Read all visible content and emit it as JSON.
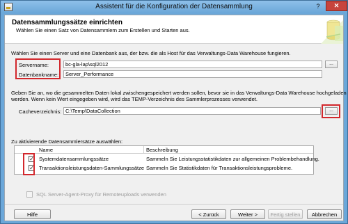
{
  "window": {
    "title": "Assistent für die Konfiguration der Datensammlung",
    "help_glyph": "?",
    "close_glyph": "✕"
  },
  "header": {
    "title": "Datensammlungssätze einrichten",
    "subtitle": "Wählen Sie einen Satz von Datensammlern zum Erstellen und Starten aus."
  },
  "server_section": {
    "instruction": "Wählen Sie einen Server und eine Datenbank aus, der bzw. die als Host für das Verwaltungs-Data Warehouse fungieren.",
    "server_label": "Servername:",
    "server_value": "bc-gla-lap\\sql2012",
    "database_label": "Datenbankname:",
    "database_value": "Server_Performance",
    "browse_label": "..."
  },
  "cache_section": {
    "instruction_line1": "Geben Sie an, wo die gesammelten Daten lokal zwischengespeichert werden sollen, bevor sie in das Verwaltungs-Data Warehouse hochgeladen",
    "instruction_line2": "werden. Wenn kein Wert eingegeben wird, wird das TEMP-Verzeichnis des Sammlerprozesses verwendet.",
    "cache_label": "Cacheverzeichnis:",
    "cache_value": "C:\\Temp\\DataCollection",
    "browse_label": "..."
  },
  "collection_sets": {
    "label": "Zu aktivierende Datensammlersätze auswählen:",
    "columns": {
      "name": "Name",
      "description": "Beschreibung"
    },
    "rows": [
      {
        "checked": true,
        "check_glyph": "✓",
        "name": "Systemdatensammlungssätze",
        "description": "Sammeln Sie Leistungsstatistikdaten zur allgemeinen Problembehandlung."
      },
      {
        "checked": true,
        "check_glyph": "✓",
        "name": "Transaktionsleistungsdaten-Sammlungssätze",
        "description": "Sammeln Sie Statistikdaten für Transaktionsleistungsprobleme."
      }
    ]
  },
  "proxy_option": {
    "label": "SQL Server-Agent-Proxy für Remoteuploads verwenden",
    "checked": false,
    "enabled": false
  },
  "buttons": {
    "help": "Hilfe",
    "back": "< Zurück",
    "next": "Weiter >",
    "finish": "Fertig stellen",
    "cancel": "Abbrechen"
  },
  "colors": {
    "highlight": "#d2272c",
    "title_bar": "#6aa6d8",
    "close_button": "#c7443d"
  }
}
